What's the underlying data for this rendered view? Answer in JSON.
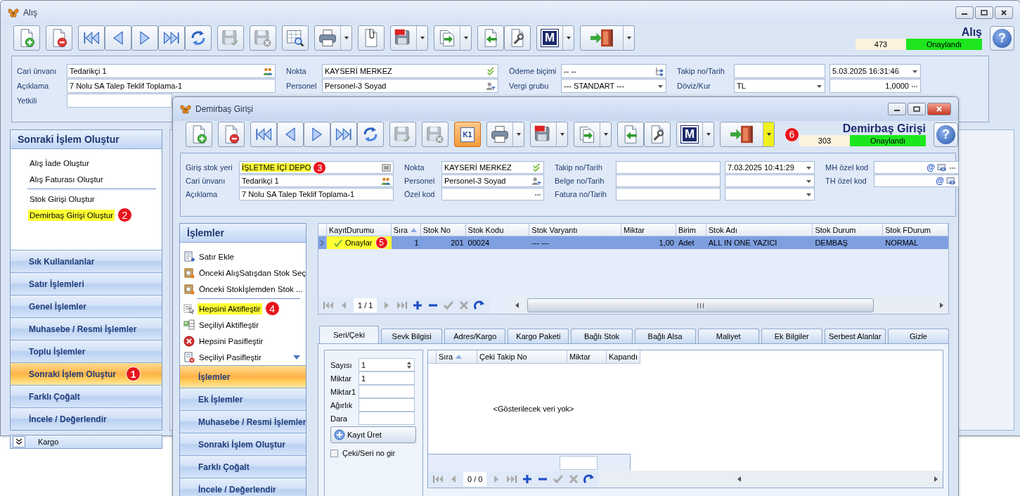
{
  "main_window": {
    "title": "Alış",
    "active": false,
    "toolbar": {
      "buttons": [
        {
          "kind": "new",
          "disabled": false,
          "dropdown": false,
          "highlighted": false
        },
        {
          "kind": "delete",
          "disabled": false,
          "dropdown": false,
          "highlighted": false
        },
        {
          "kind": "first",
          "disabled": false,
          "dropdown": false,
          "highlighted": false
        },
        {
          "kind": "prev",
          "disabled": false,
          "dropdown": false,
          "highlighted": false
        },
        {
          "kind": "next",
          "disabled": false,
          "dropdown": false,
          "highlighted": false
        },
        {
          "kind": "last",
          "disabled": false,
          "dropdown": false,
          "highlighted": false
        },
        {
          "kind": "refresh",
          "disabled": false,
          "dropdown": false,
          "highlighted": false
        },
        {
          "kind": "save",
          "disabled": true,
          "dropdown": false,
          "highlighted": false
        },
        {
          "kind": "discard",
          "disabled": true,
          "dropdown": false,
          "highlighted": false
        },
        {
          "kind": "table-search",
          "disabled": false,
          "dropdown": false,
          "highlighted": false
        },
        {
          "kind": "print",
          "disabled": false,
          "dropdown": true,
          "highlighted": false
        },
        {
          "kind": "attach",
          "disabled": false,
          "dropdown": false,
          "highlighted": false
        },
        {
          "kind": "pdf",
          "disabled": false,
          "dropdown": true,
          "highlighted": false
        },
        {
          "kind": "export",
          "disabled": false,
          "dropdown": true,
          "highlighted": false
        },
        {
          "kind": "back",
          "disabled": false,
          "dropdown": false,
          "highlighted": false
        },
        {
          "kind": "tools",
          "disabled": false,
          "dropdown": false,
          "highlighted": false
        },
        {
          "kind": "menu",
          "label": "M",
          "disabled": false,
          "dropdown": true,
          "highlighted": false
        },
        {
          "kind": "exit",
          "disabled": false,
          "dropdown": true,
          "highlighted": false
        }
      ]
    },
    "header": {
      "title": "Alış",
      "number": "473",
      "status": "Onaylandı",
      "help_label": "?"
    },
    "form": {
      "columns": [
        {
          "fields": [
            {
              "label": "Cari ünvanı",
              "inputs": [
                {
                  "kind": "contact",
                  "value": "Tedarikçi 1",
                  "highlighted": false
                }
              ]
            },
            {
              "label": "Açıklama",
              "inputs": [
                {
                  "kind": "text",
                  "value": "7 Nolu SA Talep Teklif Toplama-1",
                  "highlighted": false
                }
              ]
            },
            {
              "label": "Yetkili",
              "inputs": [
                {
                  "kind": "text",
                  "highlighted": false
                }
              ]
            }
          ]
        },
        {
          "fields": [
            {
              "label": "Nokta",
              "inputs": [
                {
                  "kind": "approve",
                  "value": "KAYSERİ MERKEZ",
                  "highlighted": false
                }
              ]
            },
            {
              "label": "Personel",
              "inputs": [
                {
                  "kind": "user",
                  "value": "Personel-3 Soyad",
                  "highlighted": false
                }
              ]
            }
          ]
        },
        {
          "fields": [
            {
              "label": "Ödeme biçimi",
              "inputs": [
                {
                  "kind": "tree",
                  "value": "-- --",
                  "highlighted": false
                }
              ]
            },
            {
              "label": "Vergi grubu",
              "inputs": [
                {
                  "kind": "combo",
                  "value": "--- STANDART ---",
                  "highlighted": false
                }
              ]
            }
          ]
        },
        {
          "fields": [
            {
              "label": "Takip no/Tarih",
              "inputs": [
                {
                  "kind": "text",
                  "highlighted": false
                },
                {
                  "kind": "combo",
                  "value": "5.03.2025 16:31:46",
                  "highlighted": false
                }
              ]
            },
            {
              "label": "Döviz/Kur",
              "inputs": [
                {
                  "kind": "combo",
                  "value": "TL",
                  "highlighted": false
                },
                {
                  "kind": "ellipsis",
                  "value": "1,0000",
                  "highlighted": false
                }
              ]
            }
          ]
        }
      ]
    },
    "side_panel": {
      "header": "Sonraki İşlem Oluştur",
      "more_below": false,
      "items": [
        {
          "kind": "link",
          "label": "Alış İade Oluştur",
          "highlighted": false
        },
        {
          "kind": "link",
          "label": "Alış Faturası Oluştur",
          "highlighted": false
        },
        {
          "kind": "separator"
        },
        {
          "kind": "link",
          "label": "Stok Girişi Oluştur",
          "highlighted": false
        },
        {
          "kind": "link",
          "label": "Demirbaş Girişi Oluştur",
          "highlighted": true,
          "callout": "2"
        }
      ],
      "groups": [
        {
          "label": "Sık Kullanılanlar",
          "selected": false
        },
        {
          "label": "Satır İşlemleri",
          "selected": false
        },
        {
          "label": "Genel İşlemler",
          "selected": false
        },
        {
          "label": "Muhasebe / Resmi İşlemler",
          "selected": false
        },
        {
          "label": "Toplu İşlemler",
          "selected": false
        },
        {
          "label": "Sonraki İşlem Oluştur",
          "selected": true,
          "callout": "1"
        },
        {
          "label": "Farklı Çoğalt",
          "selected": false
        },
        {
          "label": "İncele / Değerlendir",
          "selected": false
        }
      ],
      "footer": "Kargo"
    }
  },
  "dialog": {
    "title": "Demirbaş Girişi",
    "active": true,
    "toolbar": {
      "buttons": [
        {
          "kind": "new",
          "disabled": false,
          "dropdown": false,
          "highlighted": false
        },
        {
          "kind": "delete",
          "disabled": false,
          "dropdown": false,
          "highlighted": false
        },
        {
          "kind": "first",
          "disabled": false,
          "dropdown": false,
          "highlighted": false
        },
        {
          "kind": "prev",
          "disabled": false,
          "dropdown": false,
          "highlighted": false
        },
        {
          "kind": "next",
          "disabled": false,
          "dropdown": false,
          "highlighted": false
        },
        {
          "kind": "last",
          "disabled": false,
          "dropdown": false,
          "highlighted": false
        },
        {
          "kind": "refresh",
          "disabled": false,
          "dropdown": false,
          "highlighted": false
        },
        {
          "kind": "save",
          "disabled": true,
          "dropdown": false,
          "highlighted": false
        },
        {
          "kind": "discard",
          "disabled": true,
          "dropdown": false,
          "highlighted": false
        },
        {
          "kind": "k1",
          "label": "K1",
          "disabled": false,
          "dropdown": false,
          "highlighted": false
        },
        {
          "kind": "print",
          "disabled": false,
          "dropdown": true,
          "highlighted": false
        },
        {
          "kind": "pdf",
          "disabled": false,
          "dropdown": true,
          "highlighted": false
        },
        {
          "kind": "export",
          "disabled": false,
          "dropdown": true,
          "highlighted": false
        },
        {
          "kind": "back",
          "disabled": false,
          "dropdown": false,
          "highlighted": false
        },
        {
          "kind": "tools",
          "disabled": false,
          "dropdown": false,
          "highlighted": false
        },
        {
          "kind": "menu",
          "label": "M",
          "disabled": false,
          "dropdown": true,
          "highlighted": false
        },
        {
          "kind": "exit",
          "disabled": false,
          "dropdown": true,
          "highlighted": true,
          "callout": "6"
        }
      ]
    },
    "header": {
      "title": "Demirbaş Girişi",
      "number": "303",
      "status": "Onaylandı",
      "help_label": "?"
    },
    "form": {
      "columns": [
        {
          "fields": [
            {
              "label": "Giriş stok yeri",
              "inputs": [
                {
                  "kind": "barcode",
                  "value": "İŞLETME İÇİ DEPO",
                  "highlighted": true,
                  "callout": "3"
                }
              ]
            },
            {
              "label": "Cari ünvanı",
              "inputs": [
                {
                  "kind": "contact",
                  "value": "Tedarikçi 1",
                  "highlighted": false
                }
              ]
            },
            {
              "label": "Açıklama",
              "inputs": [
                {
                  "kind": "text",
                  "value": "7 Nolu SA Talep Teklif Toplama-1",
                  "highlighted": false
                }
              ]
            }
          ]
        },
        {
          "fields": [
            {
              "label": "Nokta",
              "inputs": [
                {
                  "kind": "approve",
                  "value": "KAYSERİ MERKEZ",
                  "highlighted": false
                }
              ]
            },
            {
              "label": "Personel",
              "inputs": [
                {
                  "kind": "user",
                  "value": "Personel-3 Soyad",
                  "highlighted": false
                }
              ]
            },
            {
              "label": "Özel kod",
              "inputs": [
                {
                  "kind": "ellipsis",
                  "highlighted": false
                }
              ]
            }
          ]
        },
        {
          "fields": [
            {
              "label": "Takip no/Tarih",
              "inputs": [
                {
                  "kind": "text",
                  "highlighted": false
                },
                {
                  "kind": "combo",
                  "value": "7.03.2025 10:41:29",
                  "highlighted": false
                }
              ]
            },
            {
              "label": "Belge no/Tarih",
              "inputs": [
                {
                  "kind": "text",
                  "highlighted": false
                },
                {
                  "kind": "combo",
                  "highlighted": false
                }
              ]
            },
            {
              "label": "Fatura no/Tarih",
              "inputs": [
                {
                  "kind": "text",
                  "highlighted": false
                },
                {
                  "kind": "combo",
                  "highlighted": false
                }
              ]
            }
          ]
        },
        {
          "fields": [
            {
              "label": "MH özel kod",
              "inputs": [
                {
                  "kind": "code",
                  "at_label": "@",
                  "more": true,
                  "highlighted": false
                }
              ]
            },
            {
              "label": "TH özel kod",
              "inputs": [
                {
                  "kind": "code",
                  "at_label": "@",
                  "more": false,
                  "highlighted": false
                }
              ]
            }
          ]
        }
      ]
    },
    "ops_panel": {
      "header": "İşlemler",
      "more_below": true,
      "items": [
        {
          "kind": "add-row",
          "label": "Satır Ekle",
          "highlighted": false
        },
        {
          "kind": "pick",
          "label": "Önceki AlışSatışdan Stok Seç",
          "highlighted": false
        },
        {
          "kind": "pick",
          "label": "Önceki Stokİşlemden Stok ...",
          "highlighted": false
        },
        {
          "kind": "separator"
        },
        {
          "kind": "select-all",
          "label": "Hepsini Aktifleştir",
          "highlighted": true,
          "callout": "4"
        },
        {
          "kind": "select-check",
          "label": "Seçiliyi Aktifleştir",
          "highlighted": false
        },
        {
          "kind": "remove-all",
          "label": "Hepsini Pasifleştir",
          "highlighted": false
        },
        {
          "kind": "remove-selected",
          "label": "Seçiliyi Pasifleştir",
          "highlighted": false
        }
      ],
      "groups": [
        {
          "label": "İşlemler",
          "selected": true
        },
        {
          "label": "Ek İşlemler",
          "selected": false
        },
        {
          "label": "Muhasebe / Resmi İşlemler",
          "selected": false
        },
        {
          "label": "Sonraki İşlem Oluştur",
          "selected": false
        },
        {
          "label": "Farklı Çoğalt",
          "selected": false
        },
        {
          "label": "İncele / Değerlendir",
          "selected": false
        }
      ]
    },
    "grid": {
      "columns": [
        {
          "label": "KayıtDurumu",
          "kind": "status",
          "sorted": false
        },
        {
          "label": "Sıra",
          "kind": "number",
          "sorted": true
        },
        {
          "label": "Stok No",
          "kind": "number",
          "sorted": false
        },
        {
          "label": "Stok Kodu",
          "kind": "text",
          "sorted": false
        },
        {
          "label": "Stok Varyantı",
          "kind": "text",
          "sorted": false
        },
        {
          "label": "Miktar",
          "kind": "number",
          "sorted": false
        },
        {
          "label": "Birim",
          "kind": "text",
          "sorted": false
        },
        {
          "label": "Stok Adı",
          "kind": "text",
          "sorted": false
        },
        {
          "label": "Stok Durum",
          "kind": "text",
          "sorted": false
        },
        {
          "label": "Stok FDurum",
          "kind": "text",
          "sorted": false
        }
      ],
      "rows": [
        {
          "selected": true,
          "status_highlighted": true,
          "callout": "5",
          "cells": [
            "Onaylar",
            "1",
            "201",
            "00024",
            "--- ---",
            "1,00",
            "Adet",
            "ALL IN ONE YAZICI",
            "DEMBAŞ",
            "NORMAL"
          ]
        }
      ],
      "navigator": "1 / 1"
    },
    "detail": {
      "tabs": [
        {
          "label": "Seri/Çeki",
          "selected": true
        },
        {
          "label": "Sevk Bilgisi",
          "selected": false
        },
        {
          "label": "Adres/Kargo",
          "selected": false
        },
        {
          "label": "Kargo Paketi",
          "selected": false
        },
        {
          "label": "Bağlı Stok",
          "selected": false
        },
        {
          "label": "Bağlı Alsa",
          "selected": false
        },
        {
          "label": "Maliyet",
          "selected": false
        },
        {
          "label": "Ek Bilgiler",
          "selected": false
        },
        {
          "label": "Serbest Alanlar",
          "selected": false
        },
        {
          "label": "Gizle",
          "selected": false
        }
      ],
      "fields": [
        {
          "label": "Sayısı",
          "kind": "spin",
          "value": "1"
        },
        {
          "label": "Miktar",
          "kind": "text",
          "value": "1"
        },
        {
          "label": "Miktar1",
          "kind": "text"
        },
        {
          "label": "Ağırlık",
          "kind": "text"
        },
        {
          "label": "Dara",
          "kind": "text"
        }
      ],
      "button": "Kayıt Üret",
      "checkbox": {
        "label": "Çeki/Seri no gir",
        "checked": false
      },
      "subgrid": {
        "columns": [
          {
            "label": "Sıra",
            "sorted": true
          },
          {
            "label": "Çeki Takip No",
            "sorted": false
          },
          {
            "label": "Miktar",
            "sorted": false
          },
          {
            "label": "Kapandı",
            "sorted": false
          }
        ],
        "empty_text": "<Gösterilecek veri yok>",
        "navigator": "0 / 0"
      }
    }
  }
}
